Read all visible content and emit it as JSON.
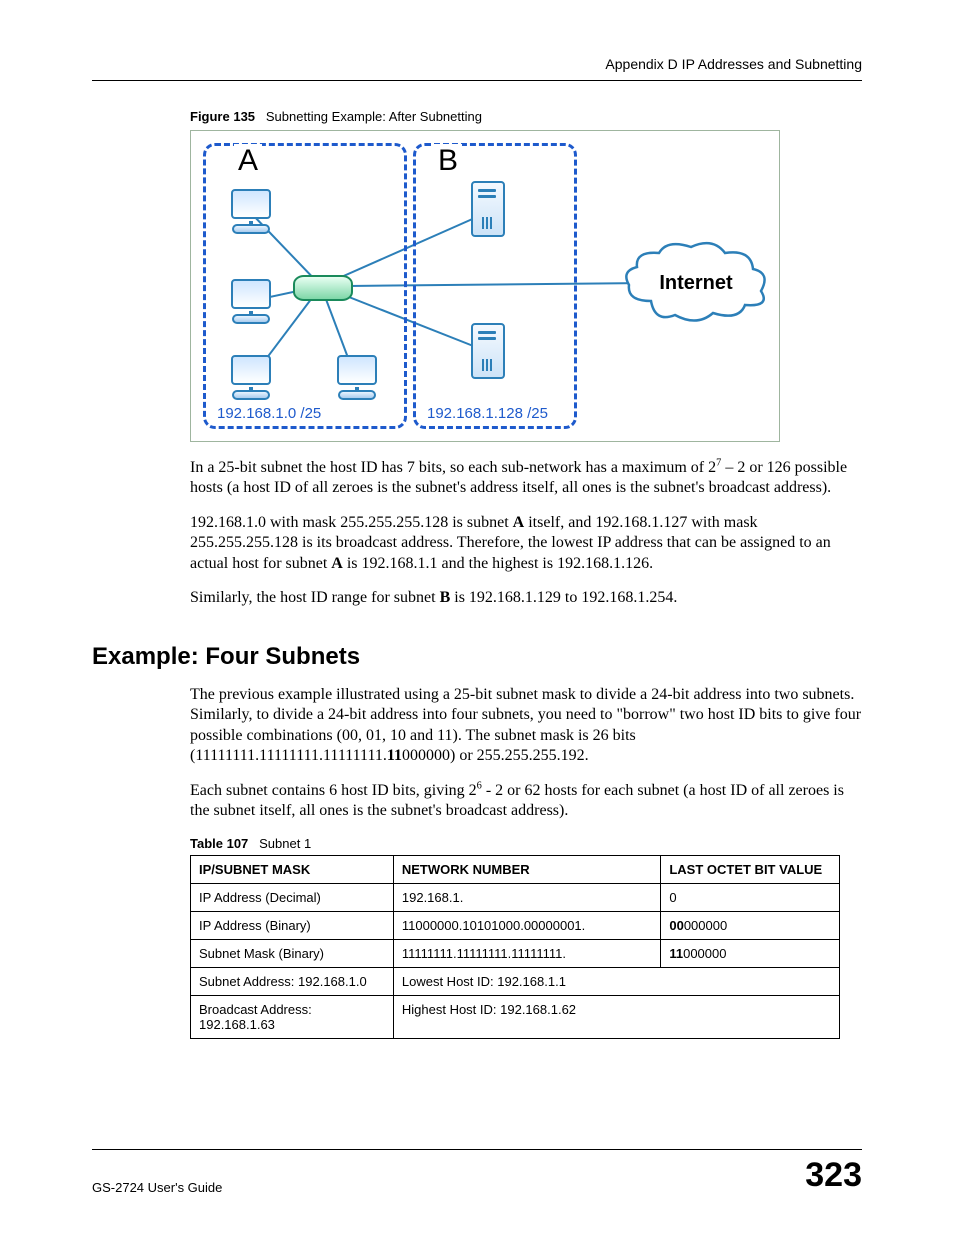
{
  "header": {
    "appendix_title": "Appendix D IP Addresses and Subnetting"
  },
  "figure": {
    "number": "Figure 135",
    "title": "Subnetting Example: After Subnetting",
    "subnet_A_label": "A",
    "subnet_B_label": "B",
    "subnet_A_cidr": "192.168.1.0 /25",
    "subnet_B_cidr": "192.168.1.128 /25",
    "cloud_label": "Internet"
  },
  "body": {
    "p1_a": "In a 25-bit subnet the host ID has 7 bits, so each sub-network has a maximum of 2",
    "p1_sup": "7",
    "p1_b": " – 2 or 126 possible hosts (a host ID of all zeroes is the subnet's address itself, all ones is the subnet's broadcast address).",
    "p2_a": "192.168.1.0 with mask 255.255.255.128 is subnet ",
    "p2_bold1": "A",
    "p2_b": " itself, and 192.168.1.127 with mask 255.255.255.128 is its broadcast address. Therefore, the lowest IP address that can be assigned to an actual host for subnet ",
    "p2_bold2": "A",
    "p2_c": " is 192.168.1.1 and the highest is 192.168.1.126.",
    "p3_a": "Similarly, the host ID range for subnet ",
    "p3_bold": "B",
    "p3_b": " is 192.168.1.129 to 192.168.1.254."
  },
  "section_heading": "Example: Four Subnets",
  "section_body": {
    "p1_a": "The previous example illustrated using a 25-bit subnet mask to divide a 24-bit address into two subnets. Similarly, to divide a 24-bit address into four subnets, you need to \"borrow\" two host ID bits to give four possible combinations (00, 01, 10 and 11). The subnet mask is 26 bits (11111111.11111111.11111111.",
    "p1_bold": "11",
    "p1_b": "000000) or 255.255.255.192.",
    "p2_a": "Each subnet contains 6 host ID bits, giving 2",
    "p2_sup": "6",
    "p2_b": " - 2 or 62 hosts for each subnet (a host ID of all zeroes is the subnet itself, all ones is the subnet's broadcast address)."
  },
  "table": {
    "caption_number": "Table 107",
    "caption_title": "Subnet 1",
    "headers": {
      "a": "IP/SUBNET MASK",
      "b": "NETWORK NUMBER",
      "c": "LAST OCTET BIT VALUE"
    },
    "rows": [
      {
        "a": "IP Address (Decimal)",
        "b": "192.168.1.",
        "c": "0",
        "c_bold": ""
      },
      {
        "a": "IP Address (Binary)",
        "b": "11000000.10101000.00000001.",
        "c_bold": "00",
        "c": "000000"
      },
      {
        "a": "Subnet Mask (Binary)",
        "b": "11111111.11111111.11111111.",
        "c_bold": "11",
        "c": "000000"
      },
      {
        "a": "Subnet Address: 192.168.1.0",
        "b_full": "Lowest Host ID: 192.168.1.1"
      },
      {
        "a": "Broadcast Address: 192.168.1.63",
        "b_full": "Highest Host ID: 192.168.1.62"
      }
    ]
  },
  "footer": {
    "guide": "GS-2724 User's Guide",
    "page": "323"
  }
}
